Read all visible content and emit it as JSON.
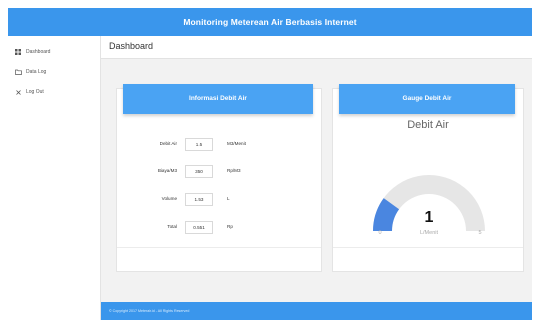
{
  "app": {
    "title": "Monitoring Meterean Air Berbasis Internet"
  },
  "sidebar": {
    "items": [
      {
        "label": "Dashboard",
        "icon": "dashboard-icon"
      },
      {
        "label": "Data Log",
        "icon": "folder-icon"
      },
      {
        "label": "Log Out",
        "icon": "close-icon"
      }
    ]
  },
  "header": {
    "title": "Dashboard"
  },
  "info_card": {
    "title": "Informasi Debit Air",
    "rows": [
      {
        "label": "Debit Air",
        "value": "1.5",
        "unit": "M3/Menit"
      },
      {
        "label": "Biaya/M3",
        "value": "350",
        "unit": "Rp/M3"
      },
      {
        "label": "Volume",
        "value": "1.53",
        "unit": "L"
      },
      {
        "label": "Total",
        "value": "0.551",
        "unit": "Rp"
      }
    ]
  },
  "gauge_card": {
    "title": "Gauge Debit Air",
    "gauge_title": "Debit Air",
    "value_text": "1",
    "unit": "L/Menit",
    "min_label": "0",
    "max_label": "5",
    "min": 0,
    "max": 5,
    "value": 1,
    "colors": {
      "fill": "#4a86e0",
      "track": "#e6e6e6"
    }
  },
  "footer": {
    "text": "© Copyright 2017 Meterair.id - All Rights Reserved"
  },
  "colors": {
    "accent": "#3a96ec",
    "card_header": "#4aa3f3"
  }
}
